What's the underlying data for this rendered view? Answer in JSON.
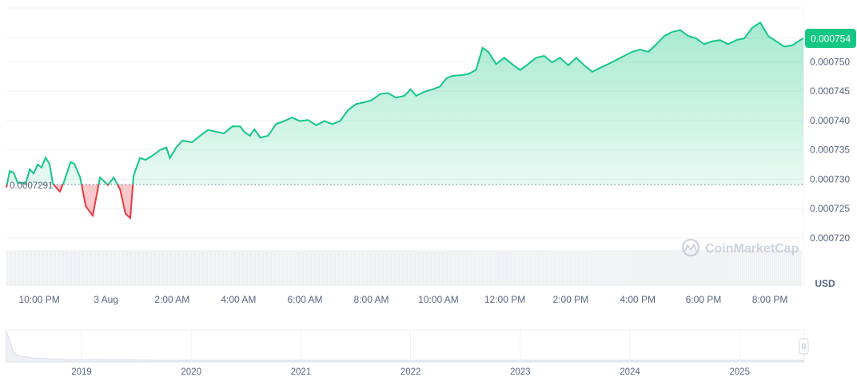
{
  "chart_data": {
    "type": "area",
    "title": "",
    "currency": "USD",
    "current_price": "0.000754",
    "baseline_label": "0.0007291",
    "baseline": 0.0007291,
    "ylim": [
      0.000718,
      0.0007575
    ],
    "y_ticks": [
      {
        "value": 0.00075,
        "label": "0.000750"
      },
      {
        "value": 0.000745,
        "label": "0.000745"
      },
      {
        "value": 0.00074,
        "label": "0.000740"
      },
      {
        "value": 0.000735,
        "label": "0.000735"
      },
      {
        "value": 0.00073,
        "label": "0.000730"
      },
      {
        "value": 0.000725,
        "label": "0.000725"
      },
      {
        "value": 0.00072,
        "label": "0.000720"
      }
    ],
    "xlim_hours": [
      0,
      24
    ],
    "x_ticks": [
      {
        "t": 0.99,
        "label": "10:00 PM"
      },
      {
        "t": 3.0,
        "label": "3 Aug"
      },
      {
        "t": 4.99,
        "label": "2:00 AM"
      },
      {
        "t": 6.99,
        "label": "4:00 AM"
      },
      {
        "t": 8.99,
        "label": "6:00 AM"
      },
      {
        "t": 10.99,
        "label": "8:00 AM"
      },
      {
        "t": 13.01,
        "label": "10:00 AM"
      },
      {
        "t": 15.01,
        "label": "12:00 PM"
      },
      {
        "t": 16.99,
        "label": "2:00 PM"
      },
      {
        "t": 19.01,
        "label": "4:00 PM"
      },
      {
        "t": 20.99,
        "label": "6:00 PM"
      },
      {
        "t": 22.99,
        "label": "8:00 PM"
      }
    ],
    "points": [
      [
        0,
        0.0007286
      ],
      [
        0.1,
        0.0007314
      ],
      [
        0.22,
        0.0007311
      ],
      [
        0.34,
        0.0007294
      ],
      [
        0.46,
        0.0007294
      ],
      [
        0.58,
        0.0007292
      ],
      [
        0.7,
        0.0007317
      ],
      [
        0.82,
        0.000731
      ],
      [
        0.94,
        0.0007325
      ],
      [
        1.06,
        0.000732
      ],
      [
        1.18,
        0.0007337
      ],
      [
        1.3,
        0.0007326
      ],
      [
        1.4,
        0.0007292
      ],
      [
        1.61,
        0.0007279
      ],
      [
        1.73,
        0.0007295
      ],
      [
        1.93,
        0.0007329
      ],
      [
        2.05,
        0.0007326
      ],
      [
        2.22,
        0.0007303
      ],
      [
        2.39,
        0.0007254
      ],
      [
        2.6,
        0.0007238
      ],
      [
        2.82,
        0.0007303
      ],
      [
        3.06,
        0.000729
      ],
      [
        3.23,
        0.0007303
      ],
      [
        3.42,
        0.0007283
      ],
      [
        3.59,
        0.0007241
      ],
      [
        3.73,
        0.0007234
      ],
      [
        3.83,
        0.0007306
      ],
      [
        4.02,
        0.0007336
      ],
      [
        4.19,
        0.0007333
      ],
      [
        4.39,
        0.000734
      ],
      [
        4.63,
        0.000735
      ],
      [
        4.82,
        0.0007354
      ],
      [
        4.92,
        0.0007336
      ],
      [
        5.11,
        0.0007354
      ],
      [
        5.3,
        0.0007366
      ],
      [
        5.59,
        0.0007363
      ],
      [
        5.83,
        0.0007374
      ],
      [
        6.07,
        0.0007384
      ],
      [
        6.31,
        0.0007381
      ],
      [
        6.55,
        0.0007378
      ],
      [
        6.8,
        0.000739
      ],
      [
        7.04,
        0.000739
      ],
      [
        7.16,
        0.0007381
      ],
      [
        7.33,
        0.0007374
      ],
      [
        7.47,
        0.0007385
      ],
      [
        7.64,
        0.0007371
      ],
      [
        7.88,
        0.0007374
      ],
      [
        8.12,
        0.0007394
      ],
      [
        8.36,
        0.0007399
      ],
      [
        8.6,
        0.0007405
      ],
      [
        8.84,
        0.0007399
      ],
      [
        9.08,
        0.0007401
      ],
      [
        9.33,
        0.0007392
      ],
      [
        9.57,
        0.0007399
      ],
      [
        9.81,
        0.0007394
      ],
      [
        10.05,
        0.0007399
      ],
      [
        10.29,
        0.0007418
      ],
      [
        10.53,
        0.0007428
      ],
      [
        10.77,
        0.0007431
      ],
      [
        11.01,
        0.0007435
      ],
      [
        11.25,
        0.0007445
      ],
      [
        11.49,
        0.0007447
      ],
      [
        11.73,
        0.0007439
      ],
      [
        11.98,
        0.0007442
      ],
      [
        12.17,
        0.0007453
      ],
      [
        12.34,
        0.0007442
      ],
      [
        12.58,
        0.0007449
      ],
      [
        12.82,
        0.0007453
      ],
      [
        13.06,
        0.0007458
      ],
      [
        13.25,
        0.0007472
      ],
      [
        13.42,
        0.0007476
      ],
      [
        13.66,
        0.0007477
      ],
      [
        13.9,
        0.0007479
      ],
      [
        14.14,
        0.0007486
      ],
      [
        14.34,
        0.0007524
      ],
      [
        14.51,
        0.0007517
      ],
      [
        14.75,
        0.0007496
      ],
      [
        14.99,
        0.0007507
      ],
      [
        15.23,
        0.0007496
      ],
      [
        15.47,
        0.0007486
      ],
      [
        15.71,
        0.0007496
      ],
      [
        15.95,
        0.0007507
      ],
      [
        16.19,
        0.000751
      ],
      [
        16.43,
        0.0007499
      ],
      [
        16.67,
        0.0007507
      ],
      [
        16.92,
        0.0007494
      ],
      [
        17.16,
        0.0007507
      ],
      [
        17.4,
        0.0007494
      ],
      [
        17.64,
        0.0007483
      ],
      [
        17.88,
        0.000749
      ],
      [
        18.12,
        0.0007496
      ],
      [
        18.36,
        0.0007503
      ],
      [
        18.6,
        0.000751
      ],
      [
        18.84,
        0.0007517
      ],
      [
        19.08,
        0.0007521
      ],
      [
        19.33,
        0.0007517
      ],
      [
        19.57,
        0.000753
      ],
      [
        19.81,
        0.0007544
      ],
      [
        20.05,
        0.0007551
      ],
      [
        20.29,
        0.0007554
      ],
      [
        20.53,
        0.0007544
      ],
      [
        20.77,
        0.000754
      ],
      [
        21.01,
        0.000753
      ],
      [
        21.25,
        0.0007535
      ],
      [
        21.49,
        0.0007537
      ],
      [
        21.73,
        0.000753
      ],
      [
        21.98,
        0.0007537
      ],
      [
        22.22,
        0.000754
      ],
      [
        22.46,
        0.0007558
      ],
      [
        22.7,
        0.0007567
      ],
      [
        22.94,
        0.0007544
      ],
      [
        23.18,
        0.0007535
      ],
      [
        23.42,
        0.0007526
      ],
      [
        23.66,
        0.0007528
      ],
      [
        23.9,
        0.0007537
      ],
      [
        24.0,
        0.000754
      ]
    ],
    "navigator": {
      "year_labels": [
        "2019",
        "2020",
        "2021",
        "2022",
        "2023",
        "2024",
        "2025"
      ]
    },
    "watermark": "CoinMarketCap",
    "colors": {
      "up": "#16c784",
      "down": "#ea3943",
      "grid": "#eff2f5",
      "text": "#58667e"
    }
  }
}
